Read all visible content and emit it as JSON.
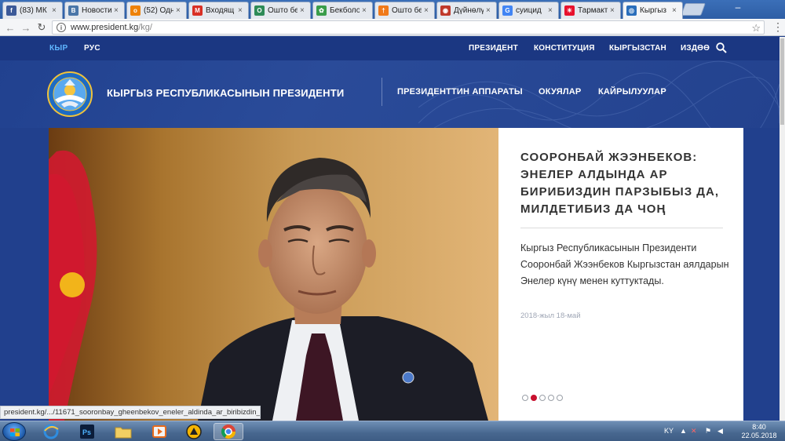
{
  "browser": {
    "tabs": [
      {
        "title": "(83) МК",
        "favicon": "facebook-icon",
        "color": "#3b5998",
        "glyph": "f"
      },
      {
        "title": "Новости",
        "favicon": "vk-icon",
        "color": "#4a76a8",
        "glyph": "B"
      },
      {
        "title": "(52) Одн",
        "favicon": "odnoklassniki-icon",
        "color": "#ee8208",
        "glyph": "o"
      },
      {
        "title": "Входящ",
        "favicon": "gmail-icon",
        "color": "#d93025",
        "glyph": "M"
      },
      {
        "title": "Ошто бе",
        "favicon": "site-icon",
        "color": "#2e8b57",
        "glyph": "O"
      },
      {
        "title": "Бекболо",
        "favicon": "leaf-icon",
        "color": "#3a9d4a",
        "glyph": "✿"
      },
      {
        "title": "Ошто бе",
        "favicon": "site-icon",
        "color": "#f07a1a",
        "glyph": "†"
      },
      {
        "title": "Дүйнөлү",
        "favicon": "eye-icon",
        "color": "#c0392b",
        "glyph": "◉"
      },
      {
        "title": "суицид",
        "favicon": "google-icon",
        "color": "#4285f4",
        "glyph": "G"
      },
      {
        "title": "Тармакт",
        "favicon": "flag-icon",
        "color": "#e8112d",
        "glyph": "☀"
      },
      {
        "title": "Кыргыз",
        "favicon": "emblem-icon",
        "color": "#2a6ebb",
        "glyph": "◎"
      }
    ],
    "url_host": "www.president.kg",
    "url_path": "/kg/",
    "status_url": "president.kg/.../11671_sooronbay_gheenbekov_eneler_aldinda_ar_biribizdin_parzibi..."
  },
  "site": {
    "lang": [
      "КЫР",
      "РУС"
    ],
    "topnav": [
      "ПРЕЗИДЕНТ",
      "КОНСТИТУЦИЯ",
      "КЫРГЫЗСТАН",
      "ИЗДӨӨ"
    ],
    "title": "КЫРГЫЗ РЕСПУБЛИКАСЫНЫН ПРЕЗИДЕНТИ",
    "mainnav": [
      "ПРЕЗИДЕНТТИН АППАРАТЫ",
      "ОКУЯЛАР",
      "КАЙРЫЛУУЛАР"
    ],
    "news": {
      "title": "СООРОНБАЙ ЖЭЭНБЕКОВ: ЭНЕЛЕР АЛДЫНДА АР БИРИБИЗДИН ПАРЗЫБЫЗ ДА, МИЛДЕТИБИЗ ДА ЧОҢ",
      "text": "Кыргыз Республикасынын Президенти Сооронбай Жээнбеков Кыргызстан аялдарын Энелер күнү менен куттуктады.",
      "date": "2018-жыл 18-май",
      "slides": 5,
      "active_slide": 2
    }
  },
  "taskbar": {
    "apps": [
      "windows-start-icon",
      "internet-explorer-icon",
      "photoshop-icon",
      "file-explorer-icon",
      "media-player-icon",
      "archicad-icon",
      "chrome-icon"
    ],
    "language": "KY",
    "time": "8:40",
    "date": "22.05.2018"
  }
}
